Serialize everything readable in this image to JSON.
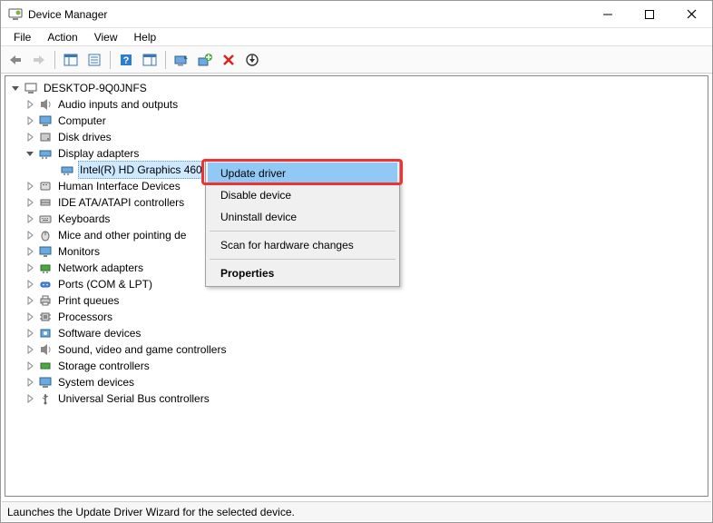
{
  "window": {
    "title": "Device Manager"
  },
  "menus": {
    "file": "File",
    "action": "Action",
    "view": "View",
    "help": "Help"
  },
  "tree": {
    "root": "DESKTOP-9Q0JNFS",
    "items": [
      "Audio inputs and outputs",
      "Computer",
      "Disk drives",
      "Display adapters",
      "Human Interface Devices",
      "IDE ATA/ATAPI controllers",
      "Keyboards",
      "Mice and other pointing de",
      "Monitors",
      "Network adapters",
      "Ports (COM & LPT)",
      "Print queues",
      "Processors",
      "Software devices",
      "Sound, video and game controllers",
      "Storage controllers",
      "System devices",
      "Universal Serial Bus controllers"
    ],
    "display_child": "Intel(R) HD Graphics 460"
  },
  "context_menu": {
    "update": "Update driver",
    "disable": "Disable device",
    "uninstall": "Uninstall device",
    "scan": "Scan for hardware changes",
    "properties": "Properties"
  },
  "status": "Launches the Update Driver Wizard for the selected device."
}
